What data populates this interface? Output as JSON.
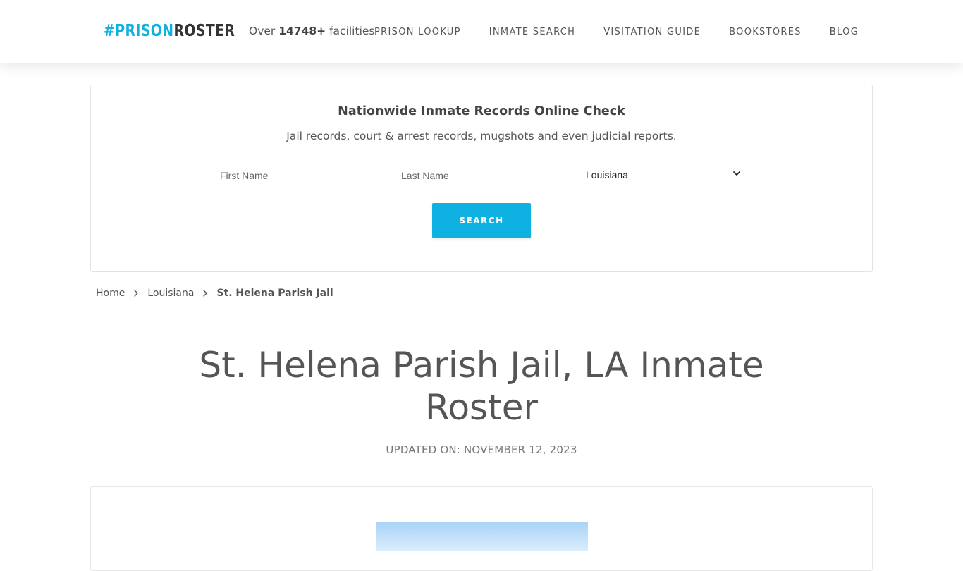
{
  "header": {
    "logo": {
      "hash": "#",
      "prison": "PRISON",
      "roster": "ROSTER"
    },
    "tagline": {
      "prefix": "Over",
      "count": "14748+",
      "suffix": "facilities"
    },
    "nav": [
      {
        "label": "PRISON LOOKUP"
      },
      {
        "label": "INMATE SEARCH"
      },
      {
        "label": "VISITATION GUIDE"
      },
      {
        "label": "BOOKSTORES"
      },
      {
        "label": "BLOG"
      }
    ]
  },
  "search": {
    "title": "Nationwide Inmate Records Online Check",
    "subtitle": "Jail records, court & arrest records, mugshots and even judicial reports.",
    "first_name_placeholder": "First Name",
    "last_name_placeholder": "Last Name",
    "state_selected": "Louisiana",
    "button_label": "SEARCH"
  },
  "breadcrumb": {
    "home": "Home",
    "state": "Louisiana",
    "current": "St. Helena Parish Jail"
  },
  "page": {
    "title": "St. Helena Parish Jail, LA Inmate Roster",
    "updated": "UPDATED ON: NOVEMBER 12, 2023"
  },
  "colors": {
    "accent": "#0fb0e2",
    "text": "#555555"
  }
}
